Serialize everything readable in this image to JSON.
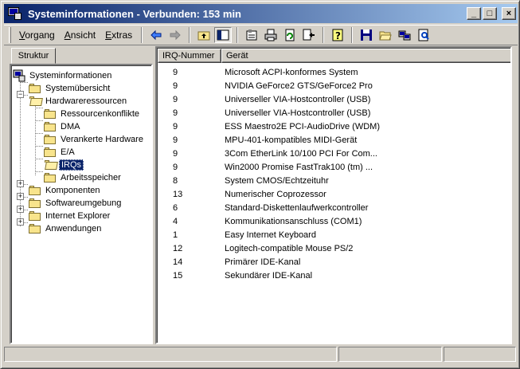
{
  "window": {
    "title": "Systeminformationen - Verbunden: 153 min",
    "controls": {
      "minimize": "_",
      "maximize": "□",
      "close": "×"
    }
  },
  "menu": [
    {
      "label": "Vorgang",
      "accel": "V",
      "rest": "organg"
    },
    {
      "label": "Ansicht",
      "accel": "A",
      "rest": "nsicht"
    },
    {
      "label": "Extras",
      "accel": "E",
      "rest": "xtras"
    }
  ],
  "toolbar_icons": [
    "back-arrow-icon",
    "forward-arrow-icon",
    "up-folder-icon",
    "show-tree-icon",
    "properties-icon",
    "print-icon",
    "refresh-icon",
    "export-icon",
    "help-icon",
    "save-icon",
    "open-icon",
    "connect-icon",
    "find-icon"
  ],
  "tabs": {
    "struktur": "Struktur"
  },
  "tree": {
    "root": "Systeminformationen",
    "items": [
      {
        "label": "Systemübersicht"
      },
      {
        "label": "Hardwareressourcen"
      },
      {
        "label": "Ressourcenkonflikte"
      },
      {
        "label": "DMA"
      },
      {
        "label": "Verankerte Hardware"
      },
      {
        "label": "E/A"
      },
      {
        "label": "IRQs"
      },
      {
        "label": "Arbeitsspeicher"
      },
      {
        "label": "Komponenten"
      },
      {
        "label": "Softwareumgebung"
      },
      {
        "label": "Internet Explorer"
      },
      {
        "label": "Anwendungen"
      }
    ]
  },
  "list": {
    "columns": [
      "IRQ-Nummer",
      "Gerät"
    ],
    "rows": [
      {
        "irq": "9",
        "device": "Microsoft ACPI-konformes System"
      },
      {
        "irq": "9",
        "device": "NVIDIA GeForce2 GTS/GeForce2 Pro"
      },
      {
        "irq": "9",
        "device": "Universeller VIA-Hostcontroller (USB)"
      },
      {
        "irq": "9",
        "device": "Universeller VIA-Hostcontroller (USB)"
      },
      {
        "irq": "9",
        "device": "ESS Maestro2E PCI-AudioDrive (WDM)"
      },
      {
        "irq": "9",
        "device": "MPU-401-kompatibles MIDI-Gerät"
      },
      {
        "irq": "9",
        "device": "3Com EtherLink 10/100 PCI For Com..."
      },
      {
        "irq": "9",
        "device": "Win2000 Promise FastTrak100 (tm) ..."
      },
      {
        "irq": "8",
        "device": "System CMOS/Echtzeituhr"
      },
      {
        "irq": "13",
        "device": "Numerischer Coprozessor"
      },
      {
        "irq": "6",
        "device": "Standard-Diskettenlaufwerkcontroller"
      },
      {
        "irq": "4",
        "device": "Kommunikationsanschluss (COM1)"
      },
      {
        "irq": "1",
        "device": "Easy Internet Keyboard"
      },
      {
        "irq": "12",
        "device": "Logitech-compatible Mouse PS/2"
      },
      {
        "irq": "14",
        "device": "Primärer IDE-Kanal"
      },
      {
        "irq": "15",
        "device": "Sekundärer IDE-Kanal"
      }
    ]
  },
  "colors": {
    "title_start": "#0a246a",
    "title_end": "#a6caf0",
    "selection": "#0a246a",
    "face": "#d4d0c8"
  }
}
